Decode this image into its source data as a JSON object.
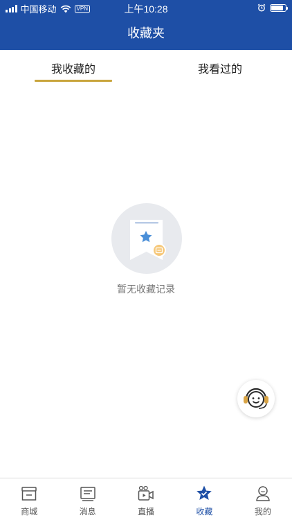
{
  "status_bar": {
    "carrier": "中国移动",
    "vpn": "VPN",
    "time": "上午10:28"
  },
  "header": {
    "title": "收藏夹",
    "bg_color": "#1e4fa6"
  },
  "tabs": [
    {
      "label": "我收藏的",
      "active": true
    },
    {
      "label": "我看过的",
      "active": false
    }
  ],
  "accent_color": "#c9a53c",
  "empty_state": {
    "icon": "favorites-empty-icon",
    "text": "暂无收藏记录"
  },
  "service_button": {
    "icon": "customer-service-icon"
  },
  "tabbar": [
    {
      "label": "商城",
      "icon": "store-icon",
      "active": false
    },
    {
      "label": "消息",
      "icon": "message-icon",
      "active": false
    },
    {
      "label": "直播",
      "icon": "live-icon",
      "active": false
    },
    {
      "label": "收藏",
      "icon": "star-icon",
      "active": true
    },
    {
      "label": "我的",
      "icon": "profile-icon",
      "active": false
    }
  ]
}
